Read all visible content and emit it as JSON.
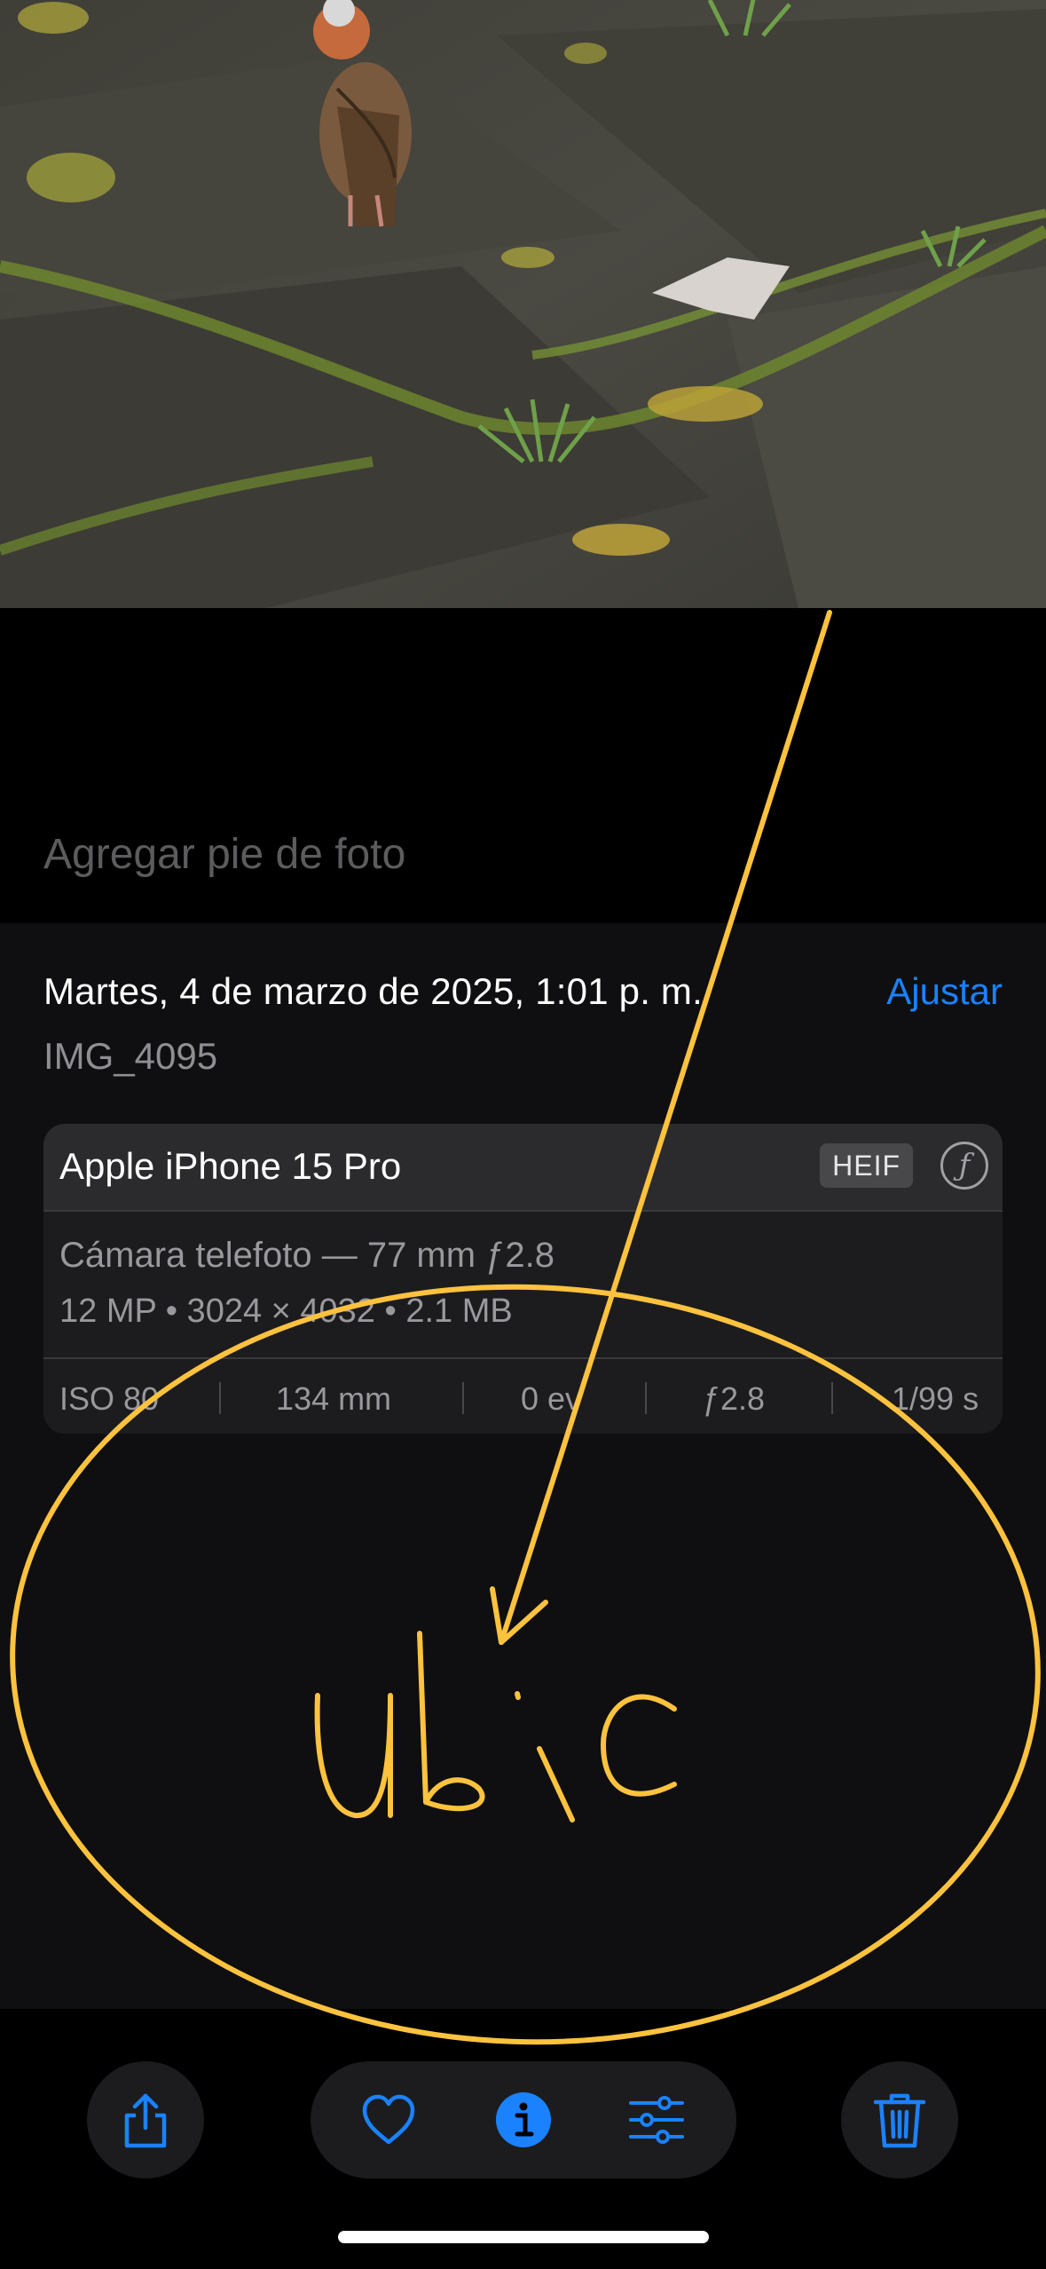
{
  "caption": {
    "placeholder": "Agregar pie de foto"
  },
  "info": {
    "date": "Martes, 4 de marzo de 2025, 1:01 p. m.",
    "adjust_label": "Ajustar",
    "filename": "IMG_4095"
  },
  "camera_card": {
    "device": "Apple iPhone 15 Pro",
    "format_badge": "HEIF",
    "lens": "Cámara telefoto — 77 mm ƒ2.8",
    "specs": "12 MP • 3024 × 4032 • 2.1 MB",
    "exif": [
      "ISO 80",
      "134 mm",
      "0 ev",
      "ƒ2.8",
      "1/99 s"
    ]
  },
  "annotation": {
    "handwritten_text": "ubic"
  },
  "toolbar": {
    "icons": [
      "share-icon",
      "heart-icon",
      "info-icon",
      "adjust-icon",
      "trash-icon"
    ],
    "accent": "#1a82ff",
    "annotation_color": "#fdc23e"
  }
}
